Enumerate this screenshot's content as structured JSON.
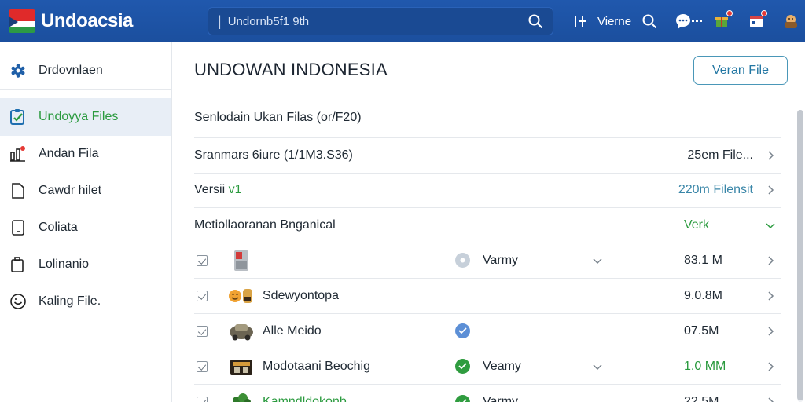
{
  "app": {
    "brand": "Undoacsia",
    "search_value": "",
    "search_placeholder": "Undornb5f1 9th",
    "topbar_label": "Vierne"
  },
  "sidebar": {
    "items": [
      {
        "label": "Drdovnlaen",
        "icon": "gear-icon"
      },
      {
        "label": "Undoyya Files",
        "icon": "checklist-icon"
      },
      {
        "label": "Andan Fila",
        "icon": "bar-chart-icon"
      },
      {
        "label": "Cawdr hilet",
        "icon": "file-icon"
      },
      {
        "label": "Coliata",
        "icon": "tablet-icon"
      },
      {
        "label": "Lolinanio",
        "icon": "clipboard-icon"
      },
      {
        "label": "Kaling File.",
        "icon": "smiley-icon"
      }
    ]
  },
  "main": {
    "title": "UNDOWAN INDONESIA",
    "version_button": "Veran File",
    "info_rows": [
      {
        "label": "Senlodain Ukan Filas (or/F20)"
      },
      {
        "label": "Sranmars 6iure (1/1M3.S36)",
        "right": "25em File..."
      },
      {
        "label_prefix": "Versii",
        "label_suffix": "v1",
        "right": "220m Filensit"
      },
      {
        "label": "Metiollaoranan Bnganical",
        "right": "Verk"
      }
    ],
    "files": [
      {
        "name": "",
        "status": "Varmy",
        "size": "83.1 M",
        "thumb": "fridge-icon",
        "status_icon": "pending-icon"
      },
      {
        "name": "Sdewyontopa",
        "status": "",
        "size": "9.0.8M",
        "thumb": "emoji-icon",
        "status_icon": ""
      },
      {
        "name": "Alle Meido",
        "status": "",
        "size": "07.5M",
        "thumb": "car-icon",
        "status_icon": "blue-check-icon"
      },
      {
        "name": "Modotaani Beochig",
        "status": "Veamy",
        "size": "1.0 MM",
        "thumb": "box-icon",
        "status_icon": "green-check-icon"
      },
      {
        "name": "Kamndldokonb",
        "status": "Varmy",
        "size": "22.5M",
        "thumb": "plant-icon",
        "status_icon": "green-check-icon"
      }
    ]
  },
  "colors": {
    "topbar": "#1b4f9e",
    "accent_green": "#2a9a3e",
    "accent_teal": "#3a86a8"
  }
}
